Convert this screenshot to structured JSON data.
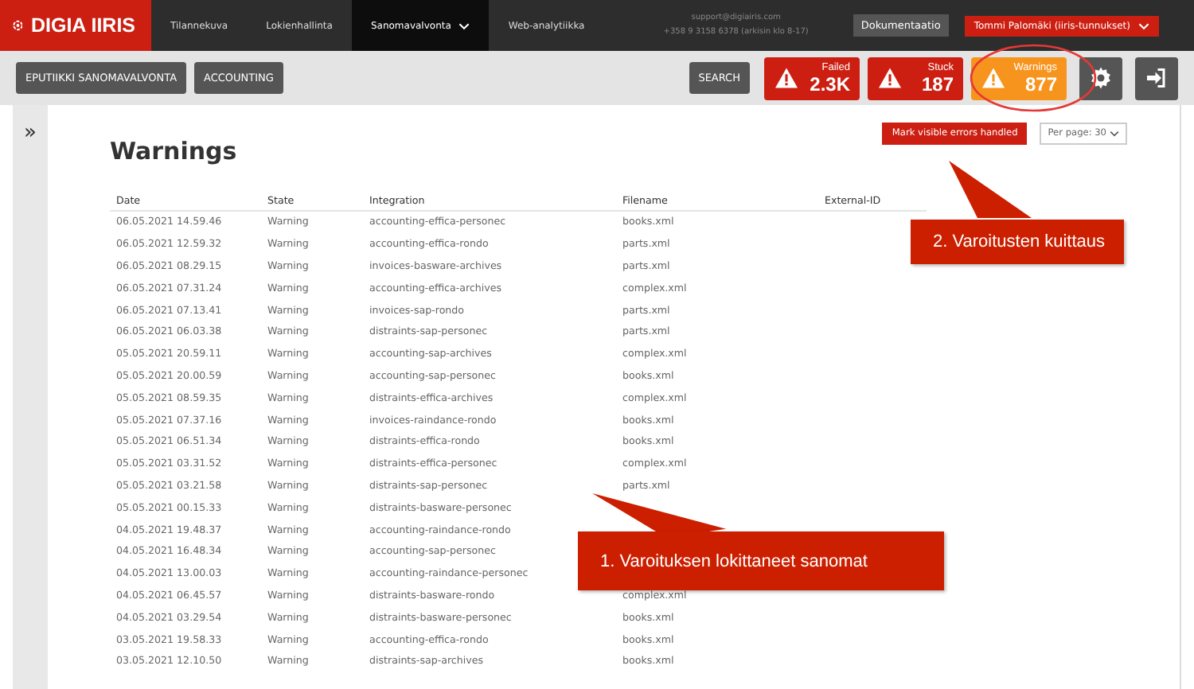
{
  "brand": "DIGIA IIRIS",
  "nav": [
    {
      "label": "Tilannekuva",
      "selected": false,
      "dropdown": false
    },
    {
      "label": "Lokienhallinta",
      "selected": false,
      "dropdown": false
    },
    {
      "label": "Sanomavalvonta",
      "selected": true,
      "dropdown": true
    },
    {
      "label": "Web-analytiikka",
      "selected": false,
      "dropdown": false
    }
  ],
  "support": {
    "email": "support@digiairis.com",
    "phone": "+358 9 3158 6378 (arkisin klo 8-17)"
  },
  "docs_button": "Dokumentaatio",
  "user_button": "Tommi Palomäki (iiris-tunnukset)",
  "toolbar_buttons": [
    "EPUTIIKKI SANOMAVALVONTA",
    "ACCOUNTING"
  ],
  "search_button": "SEARCH",
  "status_badges": [
    {
      "label": "Failed",
      "count": "2.3K",
      "color": "#cc1f12"
    },
    {
      "label": "Stuck",
      "count": "187",
      "color": "#cc1f12"
    },
    {
      "label": "Warnings",
      "count": "877",
      "color": "#f7941d"
    }
  ],
  "sidebar_toggle": "»",
  "page_title": "Warnings",
  "mark_button": "Mark visible errors handled",
  "per_page": "Per page: 30",
  "table": {
    "columns": [
      "Date",
      "State",
      "Integration",
      "Filename",
      "External-ID"
    ],
    "rows": [
      {
        "date": "06.05.2021 14.59.46",
        "state": "Warning",
        "integration": "accounting-effica-personec",
        "filename": "books.xml"
      },
      {
        "date": "06.05.2021 12.59.32",
        "state": "Warning",
        "integration": "accounting-effica-rondo",
        "filename": "parts.xml"
      },
      {
        "date": "06.05.2021 08.29.15",
        "state": "Warning",
        "integration": "invoices-basware-archives",
        "filename": "parts.xml"
      },
      {
        "date": "06.05.2021 07.31.24",
        "state": "Warning",
        "integration": "accounting-effica-archives",
        "filename": "complex.xml"
      },
      {
        "date": "06.05.2021 07.13.41",
        "state": "Warning",
        "integration": "invoices-sap-rondo",
        "filename": "parts.xml"
      },
      {
        "date": "06.05.2021 06.03.38",
        "state": "Warning",
        "integration": "distraints-sap-personec",
        "filename": "parts.xml"
      },
      {
        "date": "05.05.2021 20.59.11",
        "state": "Warning",
        "integration": "accounting-sap-archives",
        "filename": "complex.xml"
      },
      {
        "date": "05.05.2021 20.00.59",
        "state": "Warning",
        "integration": "accounting-sap-personec",
        "filename": "books.xml"
      },
      {
        "date": "05.05.2021 08.59.35",
        "state": "Warning",
        "integration": "distraints-effica-archives",
        "filename": "complex.xml"
      },
      {
        "date": "05.05.2021 07.37.16",
        "state": "Warning",
        "integration": "invoices-raindance-rondo",
        "filename": "books.xml"
      },
      {
        "date": "05.05.2021 06.51.34",
        "state": "Warning",
        "integration": "distraints-effica-rondo",
        "filename": "books.xml"
      },
      {
        "date": "05.05.2021 03.31.52",
        "state": "Warning",
        "integration": "distraints-effica-personec",
        "filename": "complex.xml"
      },
      {
        "date": "05.05.2021 03.21.58",
        "state": "Warning",
        "integration": "distraints-sap-personec",
        "filename": "parts.xml"
      },
      {
        "date": "05.05.2021 00.15.33",
        "state": "Warning",
        "integration": "distraints-basware-personec"
      },
      {
        "date": "04.05.2021 19.48.37",
        "state": "Warning",
        "integration": "accounting-raindance-rondo"
      },
      {
        "date": "04.05.2021 16.48.34",
        "state": "Warning",
        "integration": "accounting-sap-personec"
      },
      {
        "date": "04.05.2021 13.00.03",
        "state": "Warning",
        "integration": "accounting-raindance-personec"
      },
      {
        "date": "04.05.2021 06.45.57",
        "state": "Warning",
        "integration": "distraints-basware-rondo",
        "filename": "complex.xml"
      },
      {
        "date": "04.05.2021 03.29.54",
        "state": "Warning",
        "integration": "distraints-basware-personec",
        "filename": "books.xml"
      },
      {
        "date": "03.05.2021 19.58.33",
        "state": "Warning",
        "integration": "accounting-effica-rondo",
        "filename": "books.xml"
      },
      {
        "date": "03.05.2021 12.10.50",
        "state": "Warning",
        "integration": "distraints-sap-archives",
        "filename": "books.xml"
      }
    ]
  },
  "callouts": [
    "2. Varoitusten kuittaus",
    "1. Varoituksen lokittaneet sanomat"
  ]
}
